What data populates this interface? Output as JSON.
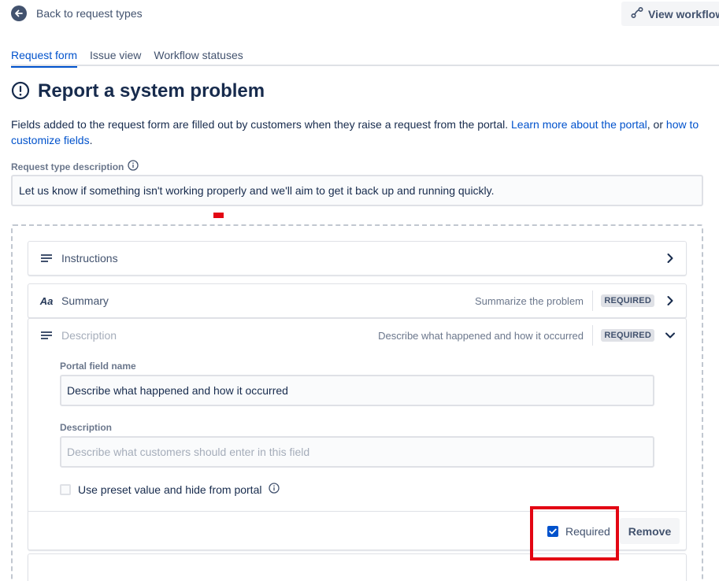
{
  "nav": {
    "back_label": "Back to request types",
    "view_workflow_label": "View workflow"
  },
  "tabs": [
    {
      "label": "Request form",
      "active": true
    },
    {
      "label": "Issue view",
      "active": false
    },
    {
      "label": "Workflow statuses",
      "active": false
    }
  ],
  "page": {
    "title": "Report a system problem",
    "intro_text": "Fields added to the request form are filled out by customers when they raise a request from the portal.",
    "intro_link1": "Learn more about the portal",
    "intro_sep": ", or",
    "intro_link2": "how to customize fields",
    "intro_end": "."
  },
  "request_type_description": {
    "label": "Request type description",
    "value": "Let us know if something isn't working properly and we'll aim to get it back up and running quickly."
  },
  "fields": [
    {
      "name": "Instructions",
      "icon": "lines-icon"
    },
    {
      "name": "Summary",
      "icon": "text-type-icon",
      "hint": "Summarize the problem",
      "badge": "REQUIRED"
    },
    {
      "name": "Description",
      "icon": "lines-icon",
      "hint": "Describe what happened and how it occurred",
      "badge": "REQUIRED",
      "expanded": true
    }
  ],
  "description_editor": {
    "portal_field_name_label": "Portal field name",
    "portal_field_name_value": "Describe what happened and how it occurred",
    "description_label": "Description",
    "description_placeholder": "Describe what customers should enter in this field",
    "preset_label": "Use preset value and hide from portal",
    "preset_checked": false,
    "required_label": "Required",
    "required_checked": true,
    "remove_label": "Remove"
  },
  "colors": {
    "accent": "#0052cc",
    "highlight": "#e30613",
    "text": "#172b4d",
    "muted": "#6b778c"
  }
}
